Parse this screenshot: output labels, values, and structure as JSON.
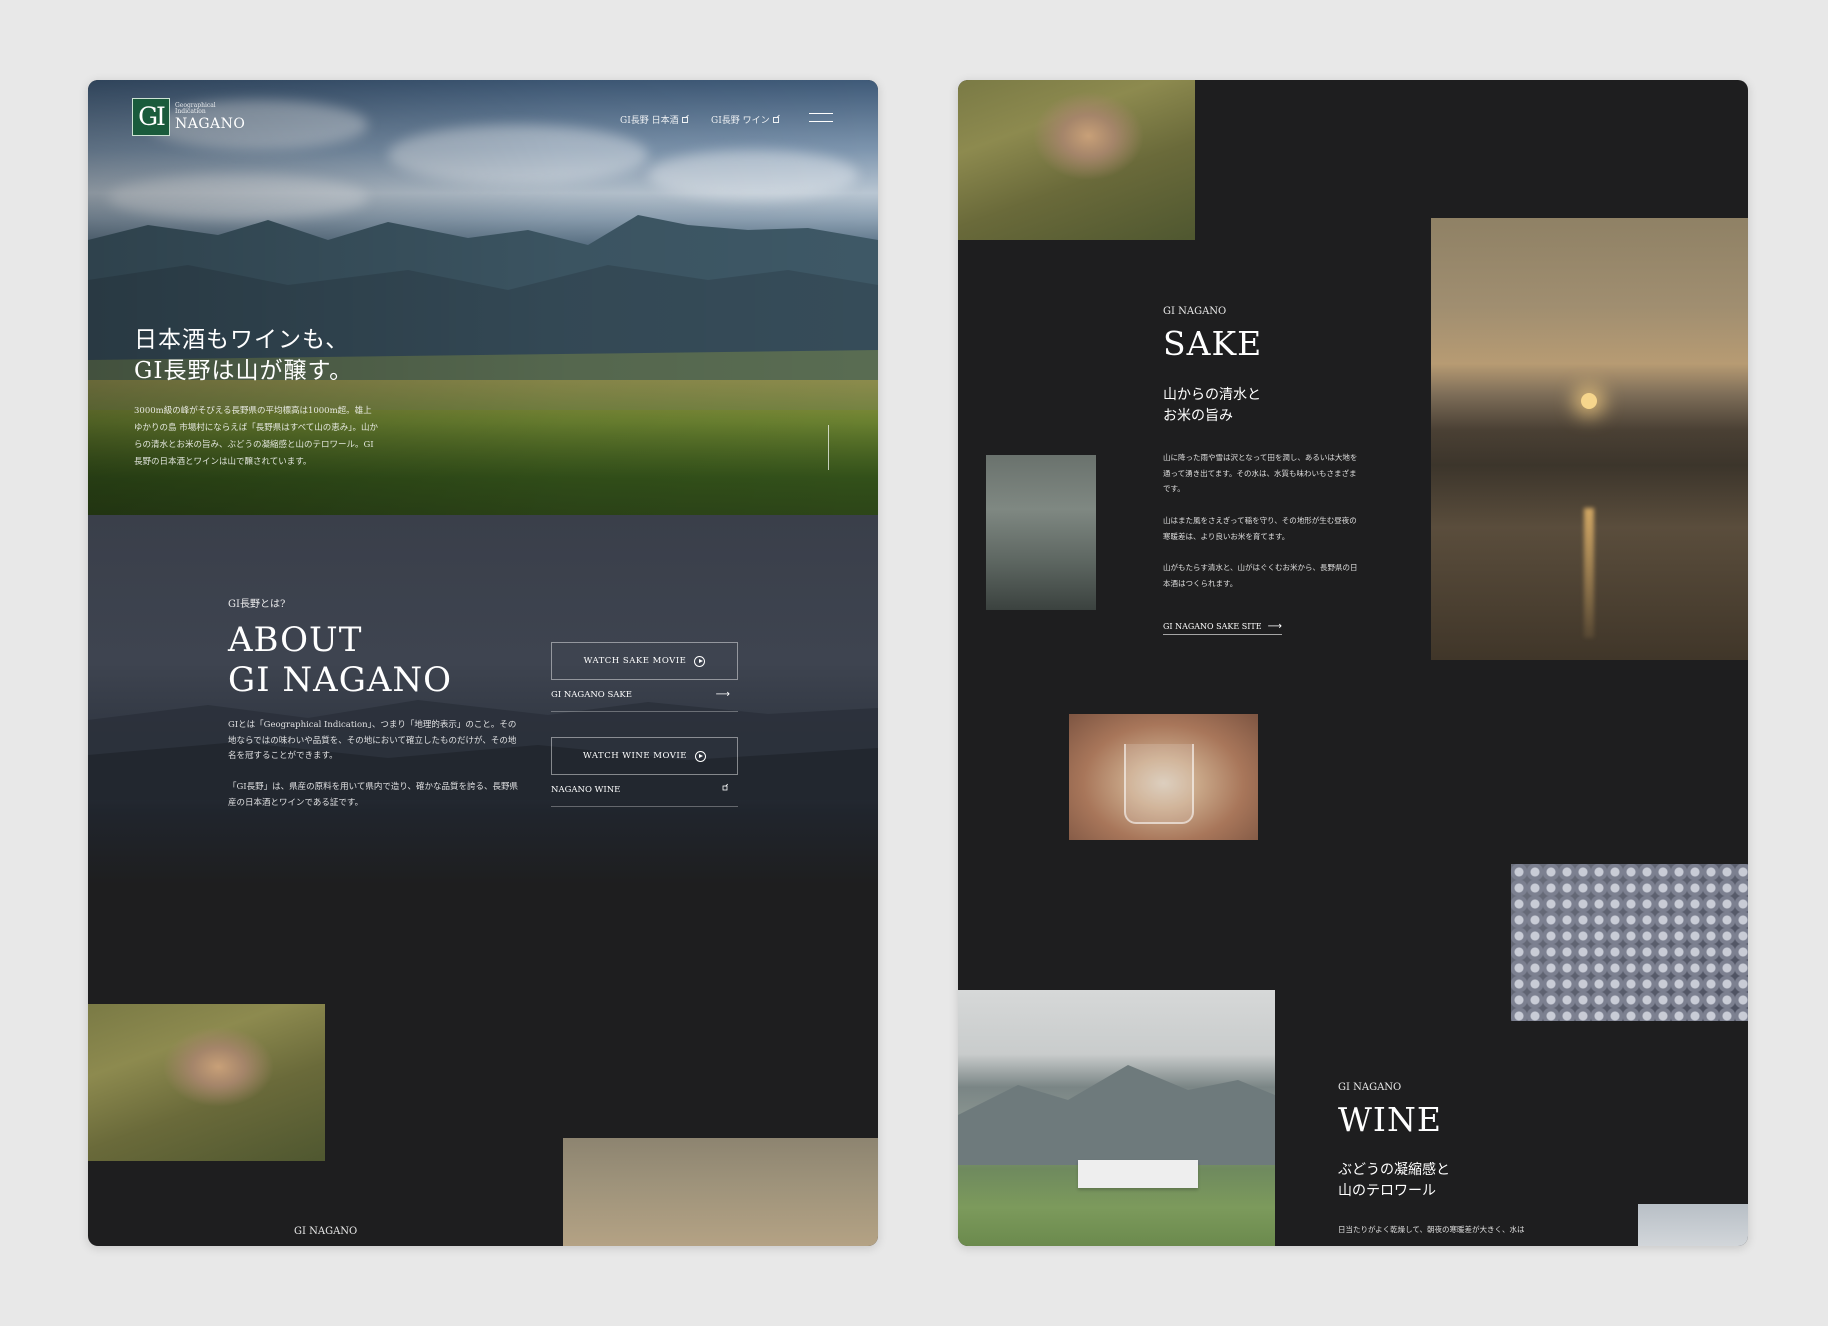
{
  "left": {
    "logo": {
      "mark": "GI",
      "small_line1": "Geographical",
      "small_line2": "Indication",
      "name": "NAGANO"
    },
    "nav": {
      "sake_label": "GI長野 日本酒",
      "wine_label": "GI長野 ワイン",
      "menu_icon": "hamburger-icon"
    },
    "hero": {
      "title_line1": "日本酒もワインも、",
      "title_line2": "GI長野は山が醸す。",
      "desc": "3000m級の峰がそびえる長野県の平均標高は1000m超。雄上ゆかりの島 市場村にならえば「長野県はすべて山の恵み」。山からの清水とお米の旨み、ぶどうの凝縮感と山のテロワール。GI長野の日本酒とワインは山で醸されています。"
    },
    "about": {
      "eyebrow": "GI長野とは?",
      "title_line1": "ABOUT",
      "title_line2": "GI NAGANO",
      "p1": "GIとは「Geographical Indication」、つまり「地理的表示」のこと。その地ならではの味わいや品質を、その地において確立したものだけが、その地名を冠することができます。",
      "p2": "「GI長野」は、県産の原料を用いて県内で造り、確かな品質を誇る、長野県産の日本酒とワインである証です。",
      "btn_sake_movie": "WATCH SAKE MOVIE",
      "link_sake": "GI NAGANO SAKE",
      "btn_wine_movie": "WATCH WINE MOVIE",
      "link_wine": "NAGANO WINE"
    },
    "footer_label": "GI NAGANO"
  },
  "right": {
    "sake": {
      "eyebrow": "GI NAGANO",
      "title": "SAKE",
      "sub_line1": "山からの清水と",
      "sub_line2": "お米の旨み",
      "p1": "山に降った雨や雪は沢となって田を潤し、あるいは大地を通って湧き出てます。その水は、水質も味わいもさまざまです。",
      "p2": "山はまた風をさえぎって稲を守り、その地形が生む昼夜の寒暖差は、より良いお米を育てます。",
      "p3": "山がもたらす清水と、山がはぐくむお米から、長野県の日本酒はつくられます。",
      "link": "GI NAGANO SAKE SITE"
    },
    "wine": {
      "eyebrow": "GI NAGANO",
      "title": "WINE",
      "sub_line1": "ぶどうの凝縮感と",
      "sub_line2": "山のテロワール",
      "p1": "日当たりがよく乾燥して、朝夜の寒暖差が大きく、水は"
    }
  },
  "colors": {
    "page_bg": "#e8e8e8",
    "panel_bg": "#1e1e1f",
    "logo_green": "#1a5b3c"
  }
}
